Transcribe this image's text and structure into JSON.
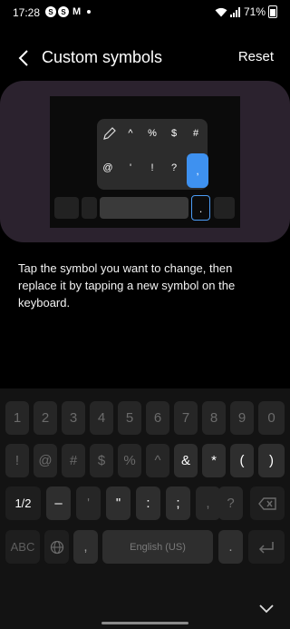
{
  "status_bar": {
    "time": "17:28",
    "app_badges": [
      "S",
      "S"
    ],
    "mail_icon": "M",
    "battery": "71%"
  },
  "header": {
    "title": "Custom symbols",
    "reset_label": "Reset"
  },
  "preview": {
    "popup_row1": [
      "^",
      "%",
      "$",
      "#"
    ],
    "popup_row2": [
      "@",
      "'",
      "!",
      "?"
    ],
    "selected_symbol": ",",
    "period_symbol": "."
  },
  "instruction": "Tap the symbol you want to change, then replace it by tapping a new symbol on the keyboard.",
  "keyboard": {
    "row1": [
      "1",
      "2",
      "3",
      "4",
      "5",
      "6",
      "7",
      "8",
      "9",
      "0"
    ],
    "row2": [
      "!",
      "@",
      "#",
      "$",
      "%",
      "^",
      "&",
      "*",
      "(",
      ")"
    ],
    "row3": [
      "1/2",
      "–",
      "'",
      "\"",
      ":",
      ";",
      ",",
      "?"
    ],
    "row4": {
      "abc": "ABC",
      "comma": ",",
      "space": "English (US)",
      "period": "."
    }
  },
  "colors": {
    "accent": "#3e91f0",
    "preview_bg": "#2b222e",
    "key_bg": "#2e2e2e"
  }
}
